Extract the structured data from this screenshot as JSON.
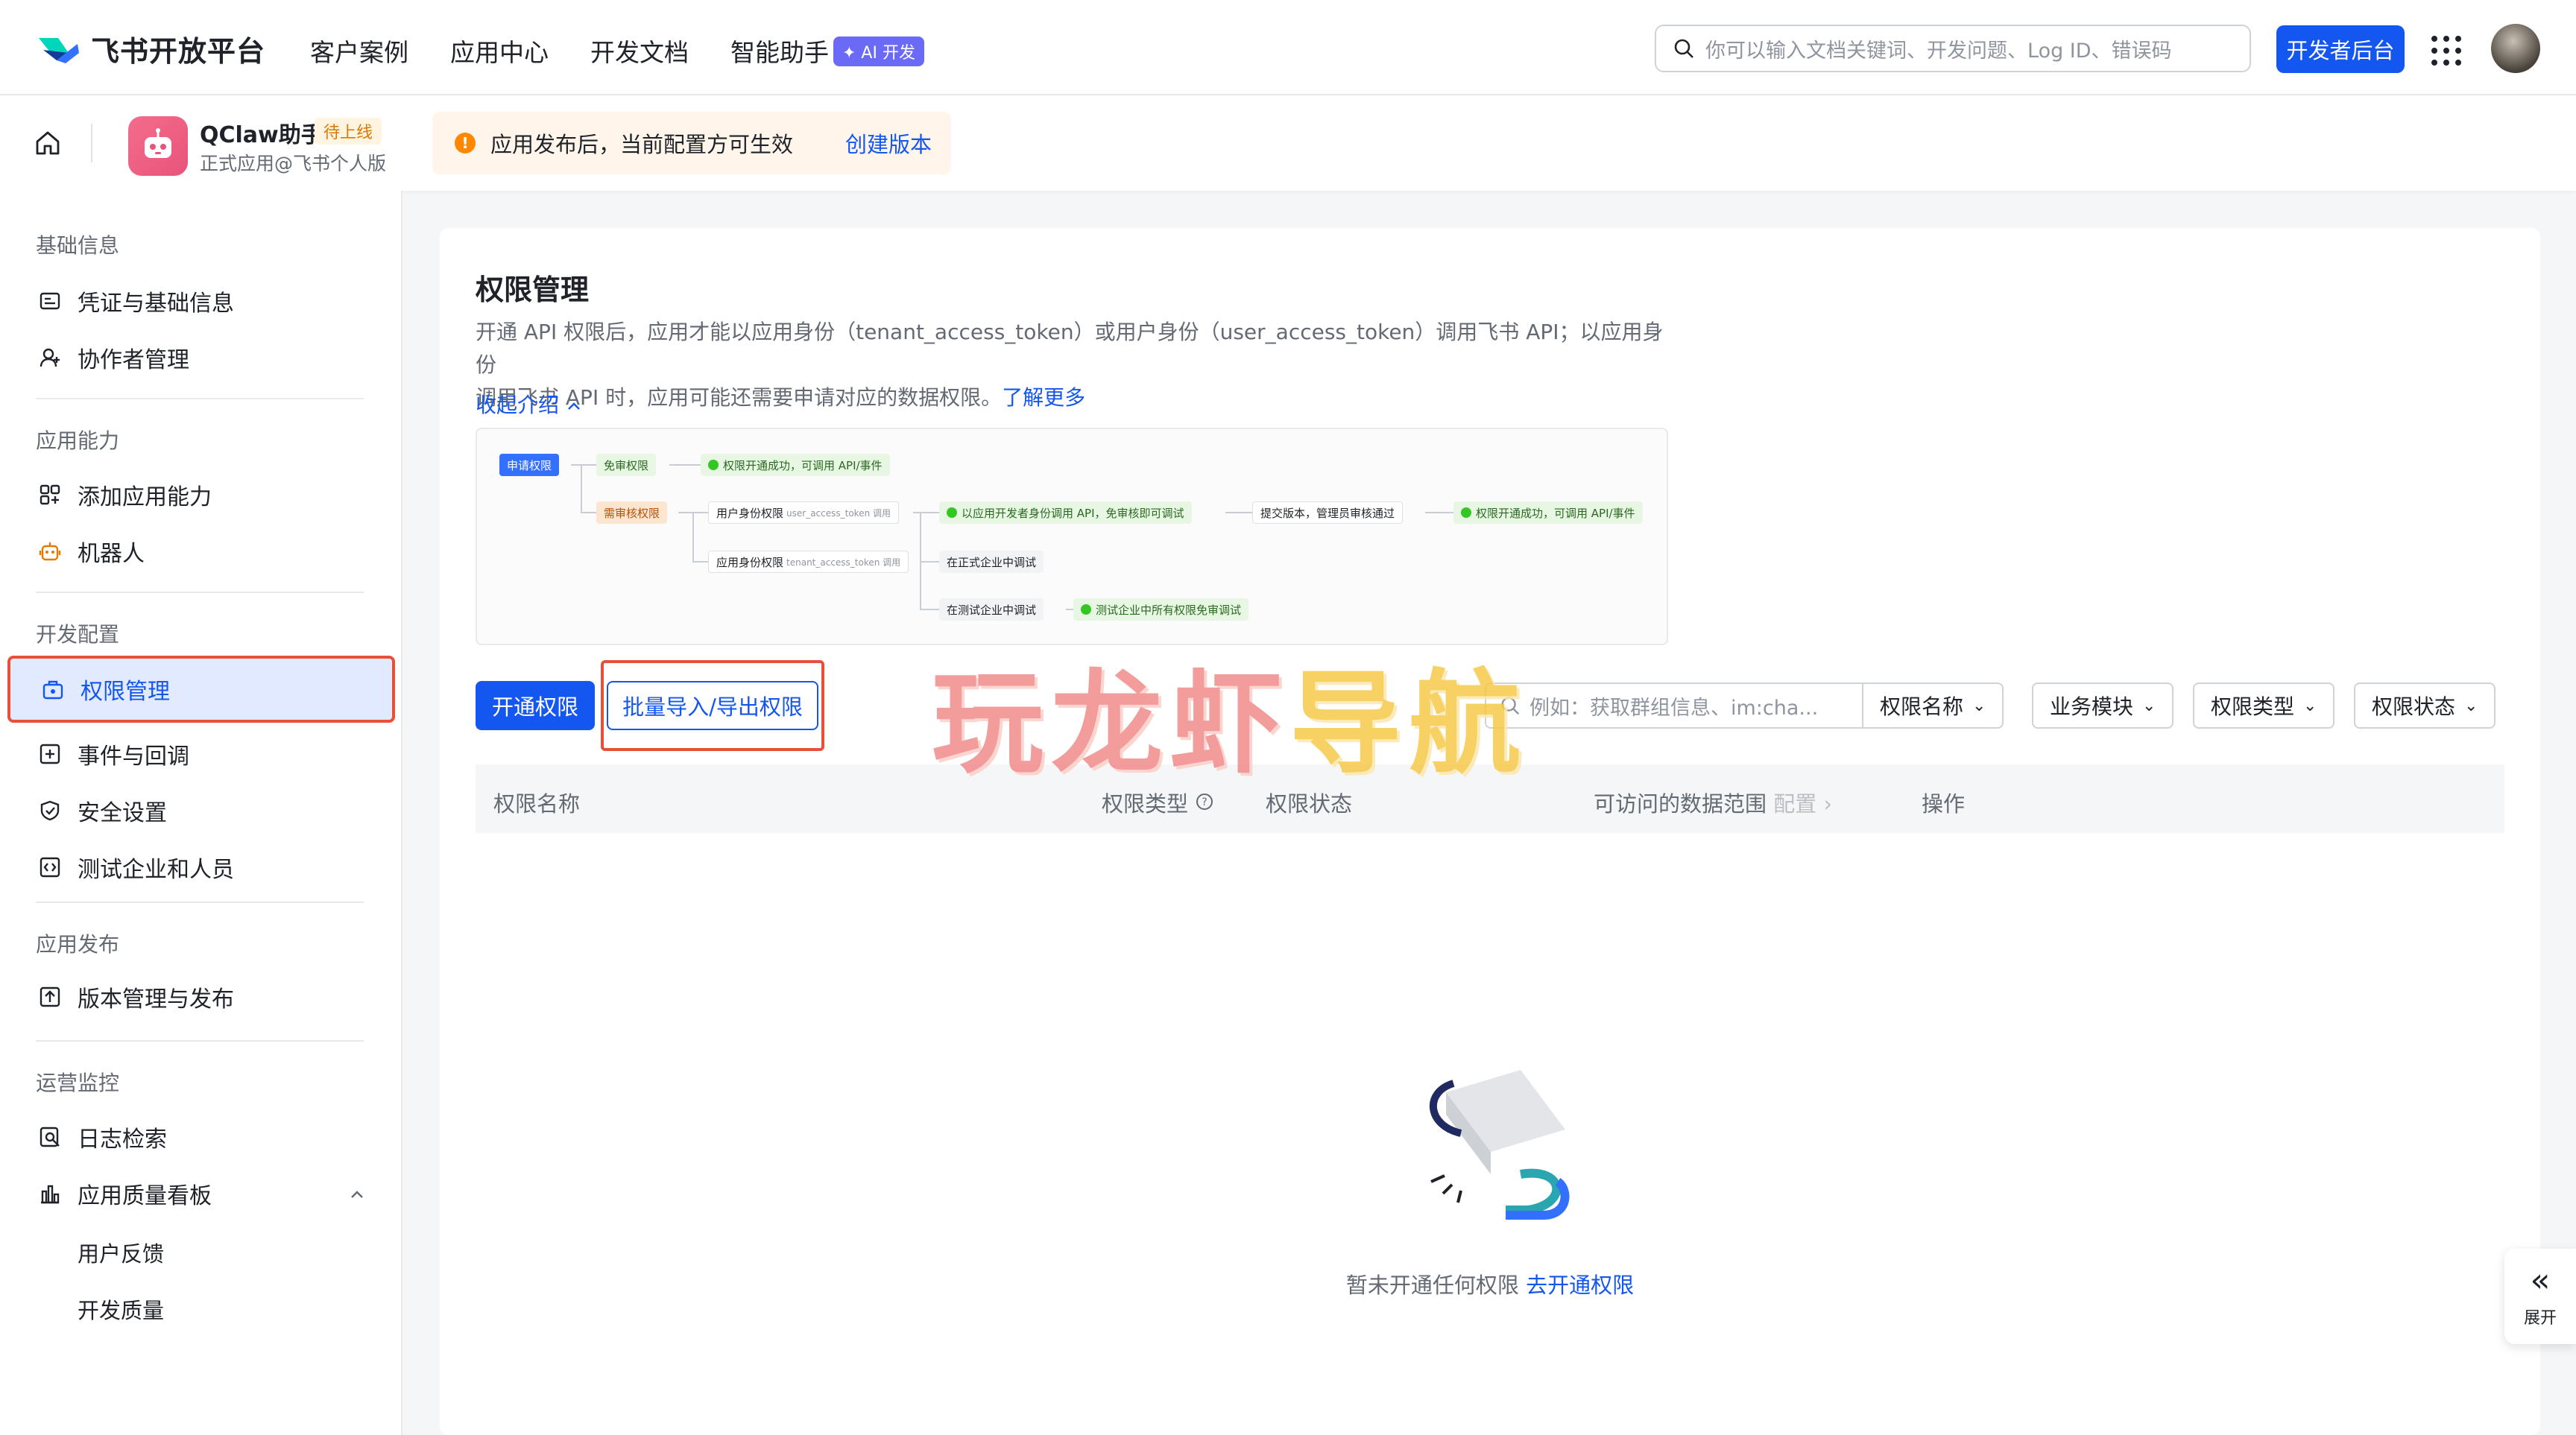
{
  "topbar": {
    "brand": "飞书开放平台",
    "nav": [
      "客户案例",
      "应用中心",
      "开发文档",
      "智能助手"
    ],
    "ai_badge": "✦ AI 开发",
    "search_placeholder": "你可以输入文档关键词、开发问题、Log ID、错误码",
    "dev_console": "开发者后台"
  },
  "app": {
    "name": "QClaw助手",
    "status": "待上线",
    "subtitle": "正式应用@飞书个人版"
  },
  "notice": {
    "icon": "!",
    "text": "应用发布后，当前配置方可生效",
    "link": "创建版本"
  },
  "sidebar": {
    "groups": [
      "基础信息",
      "应用能力",
      "开发配置",
      "应用发布",
      "运营监控"
    ],
    "items": {
      "credentials": "凭证与基础信息",
      "collaborators": "协作者管理",
      "add_capability": "添加应用能力",
      "bot": "机器人",
      "permissions": "权限管理",
      "events": "事件与回调",
      "security": "安全设置",
      "test_org": "测试企业和人员",
      "versions": "版本管理与发布",
      "logs": "日志检索",
      "quality": "应用质量看板",
      "feedback": "用户反馈",
      "dev_quality": "开发质量"
    }
  },
  "main": {
    "title": "权限管理",
    "intro_line1": "开通 API 权限后，应用才能以应用身份（tenant_access_token）或用户身份（user_access_token）调用飞书 API；以应用身份",
    "intro_line2": "调用飞书 API 时，应用可能还需要申请对应的数据权限。",
    "learn_more": "了解更多",
    "collapse": "收起介绍",
    "flow": {
      "apply": "申请权限",
      "free": "免审权限",
      "free_ok": "权限开通成功，可调用 API/事件",
      "review": "需审核权限",
      "user_identity": "用户身份权限",
      "user_token_note": "user_access_token 调用",
      "dev_identity": "以应用开发者身份调用 API，免审核即可调试",
      "submit": "提交版本，管理员审核通过",
      "review_ok": "权限开通成功，可调用 API/事件",
      "app_identity": "应用身份权限",
      "tenant_token_note": "tenant_access_token 调用",
      "prod_debug": "在正式企业中调试",
      "test_debug": "在测试企业中调试",
      "test_free": "测试企业中所有权限免审调试"
    },
    "btn_enable": "开通权限",
    "btn_batch": "批量导入/导出权限",
    "filter_placeholder": "例如：获取群组信息、im:cha...",
    "filters": [
      "权限名称",
      "业务模块",
      "权限类型",
      "权限状态"
    ],
    "columns": {
      "name": "权限名称",
      "type": "权限类型",
      "status": "权限状态",
      "scope": "可访问的数据范围",
      "scope_config": "配置",
      "action": "操作"
    },
    "empty_text": "暂未开通任何权限",
    "empty_link": "去开通权限"
  },
  "watermark": {
    "red": "玩龙虾",
    "yellow": "导航"
  },
  "expand": "展开"
}
